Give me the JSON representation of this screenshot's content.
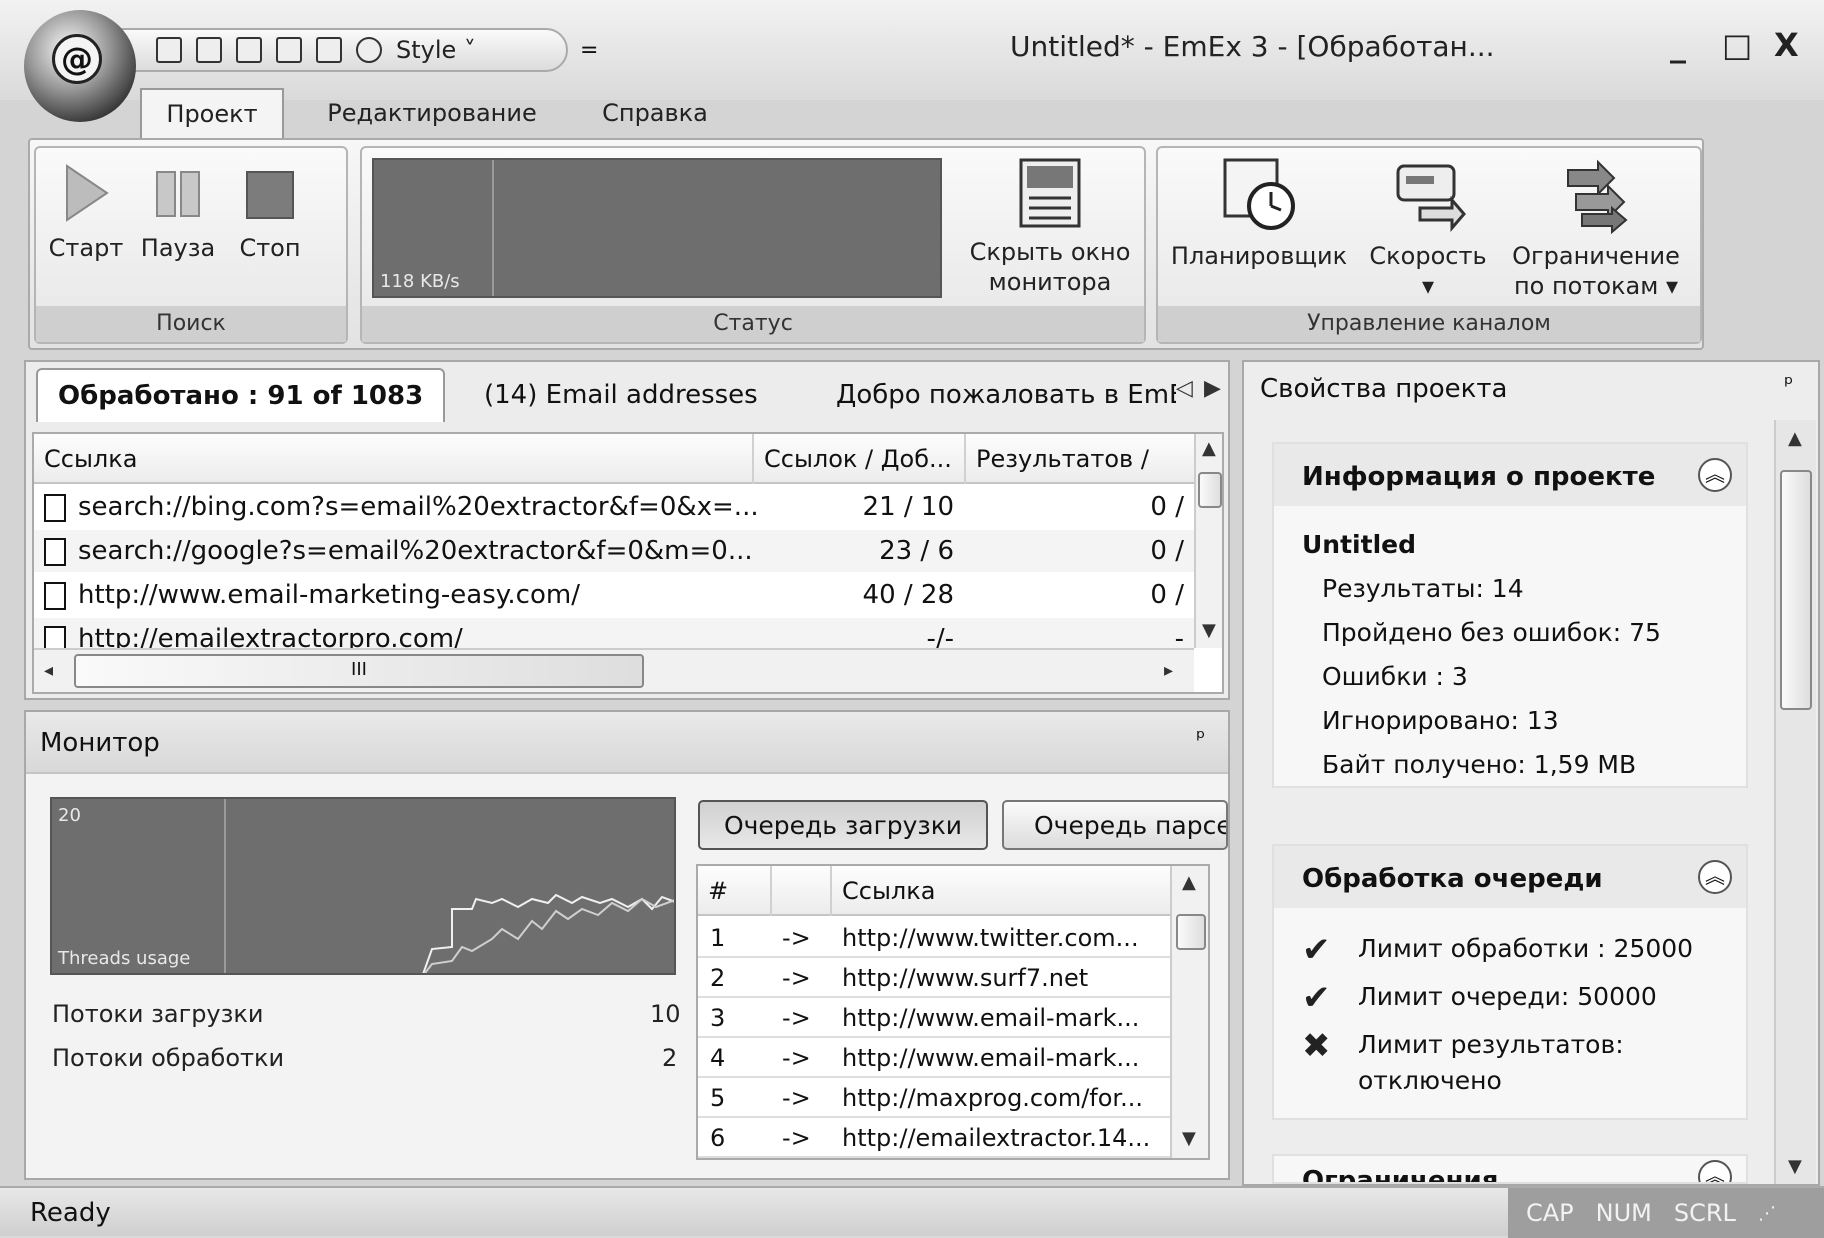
{
  "window": {
    "title": "Untitled* - EmEx 3 - [Обработан...",
    "minimize": "_",
    "maximize": "□",
    "close": "X"
  },
  "qat": {
    "style_label": "Style ˅",
    "dropdown": "="
  },
  "ribbon": {
    "tabs": [
      "Проект",
      "Редактирование",
      "Справка"
    ],
    "search_group": {
      "label": "Поиск",
      "start": "Старт",
      "pause": "Пауза",
      "stop": "Стоп"
    },
    "status_group": {
      "label": "Статус",
      "speed": "118 KB/s",
      "hide_monitor_line1": "Скрыть окно",
      "hide_monitor_line2": "монитора"
    },
    "channel_group": {
      "label": "Управление каналом",
      "scheduler": "Планировщик",
      "speed": "Скорость",
      "limit_line1": "Ограничение",
      "limit_line2": "по потокам ▾"
    }
  },
  "main": {
    "tabs": [
      "Обработано : 91 of 1083",
      "(14) Email addresses",
      "Добро пожаловать в EmE"
    ],
    "columns": [
      "Ссылка",
      "Ссылок / Доб...",
      "Результатов / "
    ],
    "rows": [
      {
        "url": "search://bing.com?s=email%20extractor&f=0&x=...",
        "links": "21 / 10",
        "results": "0 /"
      },
      {
        "url": "search://google?s=email%20extractor&f=0&m=0...",
        "links": "23 / 6",
        "results": "0 /"
      },
      {
        "url": "http://www.email-marketing-easy.com/",
        "links": "40 / 28",
        "results": "0 /"
      },
      {
        "url": "http://emailextractorpro.com/",
        "links": "-/-",
        "results": "-"
      }
    ],
    "hscroll_label": "III"
  },
  "monitor": {
    "title": "Монитор",
    "pin": "ᵖ",
    "graph_max": "20",
    "graph_label": "Threads usage",
    "download_threads_label": "Потоки загрузки",
    "download_threads_value": "10",
    "processing_threads_label": "Потоки обработки",
    "processing_threads_value": "2",
    "queue_buttons": [
      "Очередь загрузки",
      "Очередь парсер"
    ],
    "queue_columns": [
      "#",
      "",
      "Ссылка"
    ],
    "queue_rows": [
      {
        "n": "1",
        "arrow": "->",
        "url": "http://www.twitter.com..."
      },
      {
        "n": "2",
        "arrow": "->",
        "url": "http://www.surf7.net"
      },
      {
        "n": "3",
        "arrow": "->",
        "url": "http://www.email-mark..."
      },
      {
        "n": "4",
        "arrow": "->",
        "url": "http://www.email-mark..."
      },
      {
        "n": "5",
        "arrow": "->",
        "url": "http://maxprog.com/for..."
      },
      {
        "n": "6",
        "arrow": "->",
        "url": "http://emailextractor.14..."
      }
    ]
  },
  "properties": {
    "title": "Свойства проекта",
    "pin": "ᵖ",
    "info": {
      "title": "Информация о проекте",
      "project_name": "Untitled",
      "results": "Результаты: 14",
      "passed": "Пройдено без ошибок: 75",
      "errors": "Ошибки : 3",
      "ignored": "Игнорировано: 13",
      "bytes": "Байт получено: 1,59 MB"
    },
    "queue": {
      "title": "Обработка очереди",
      "limit_processing": "Лимит обработки : 25000",
      "limit_queue": "Лимит очереди: 50000",
      "limit_results_line1": "Лимит результатов:",
      "limit_results_line2": "отключено"
    },
    "limits_title": "Ограничения"
  },
  "statusbar": {
    "ready": "Ready",
    "cap": "CAP",
    "num": "NUM",
    "scrl": "SCRL"
  }
}
